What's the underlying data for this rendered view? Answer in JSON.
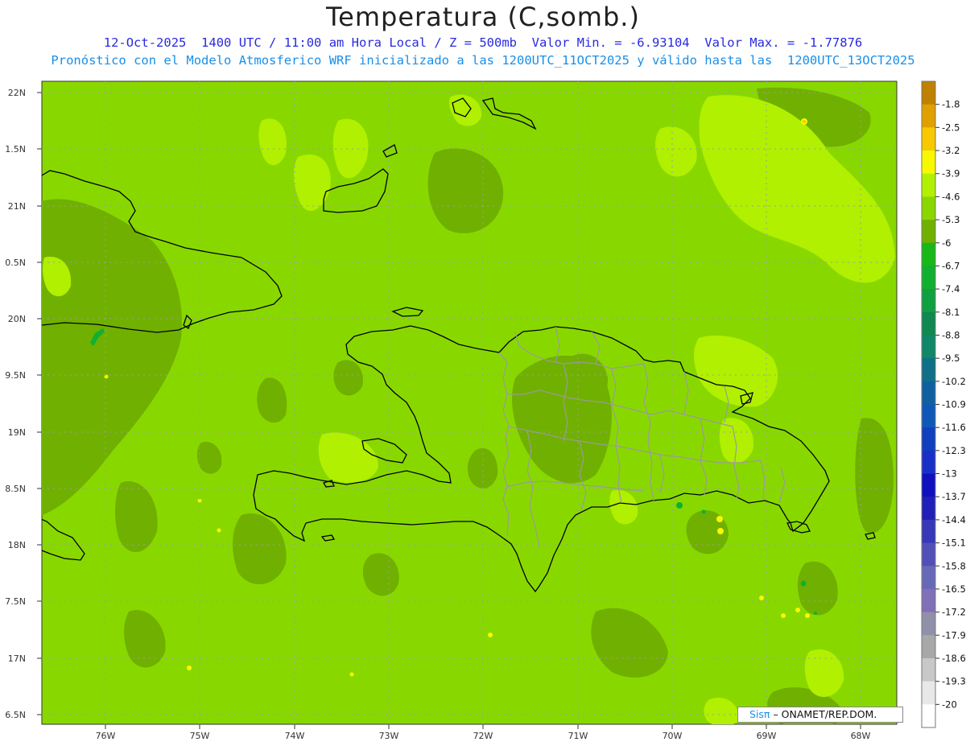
{
  "header": {
    "title": "Temperatura (C,somb.)",
    "line1": "12-Oct-2025  1400 UTC / 11:00 am Hora Local / Z = 500mb  Valor Min. = -6.93104  Valor Max. = -1.77876",
    "line2": "Pronóstico con el Modelo Atmosferico WRF inicializado a las 1200UTC_11OCT2025 y válido hasta las  1200UTC_13OCT2025"
  },
  "axes": {
    "lat_labels": [
      "22N",
      "1.5N",
      "21N",
      "0.5N",
      "20N",
      "9.5N",
      "19N",
      "8.5N",
      "18N",
      "7.5N",
      "17N",
      "6.5N"
    ],
    "lon_labels": [
      "76W",
      "75W",
      "74W",
      "73W",
      "72W",
      "71W",
      "70W",
      "69W",
      "68W"
    ]
  },
  "colorbar": {
    "labels": [
      "-1.8",
      "-2.5",
      "-3.2",
      "-3.9",
      "-4.6",
      "-5.3",
      "-6",
      "-6.7",
      "-7.4",
      "-8.1",
      "-8.8",
      "-9.5",
      "-10.2",
      "-10.9",
      "-11.6",
      "-12.3",
      "-13",
      "-13.7",
      "-14.4",
      "-15.1",
      "-15.8",
      "-16.5",
      "-17.2",
      "-17.9",
      "-18.6",
      "-19.3",
      "-20"
    ],
    "colors": [
      "#c08000",
      "#e0a000",
      "#f8c800",
      "#f8f800",
      "#b0f000",
      "#88d800",
      "#70b000",
      "#18b818",
      "#10b030",
      "#10a040",
      "#108850",
      "#108868",
      "#107088",
      "#1060a0",
      "#1058b8",
      "#1040c0",
      "#1830c8",
      "#1010c0",
      "#2020b8",
      "#3838b8",
      "#5050b8",
      "#6868b8",
      "#8070b8",
      "#9090a8",
      "#a8a8a8",
      "#c8c8c8",
      "#e8e8e8",
      "#ffffff"
    ]
  },
  "legend_credit": {
    "brand": "Sisπ",
    "org": "– ONAMET/REP.DOM."
  },
  "field_colors": {
    "base": "#88d800",
    "darker": "#70b000",
    "lighter": "#b0f000",
    "coast": "#000000",
    "province": "#9a9a9a"
  }
}
